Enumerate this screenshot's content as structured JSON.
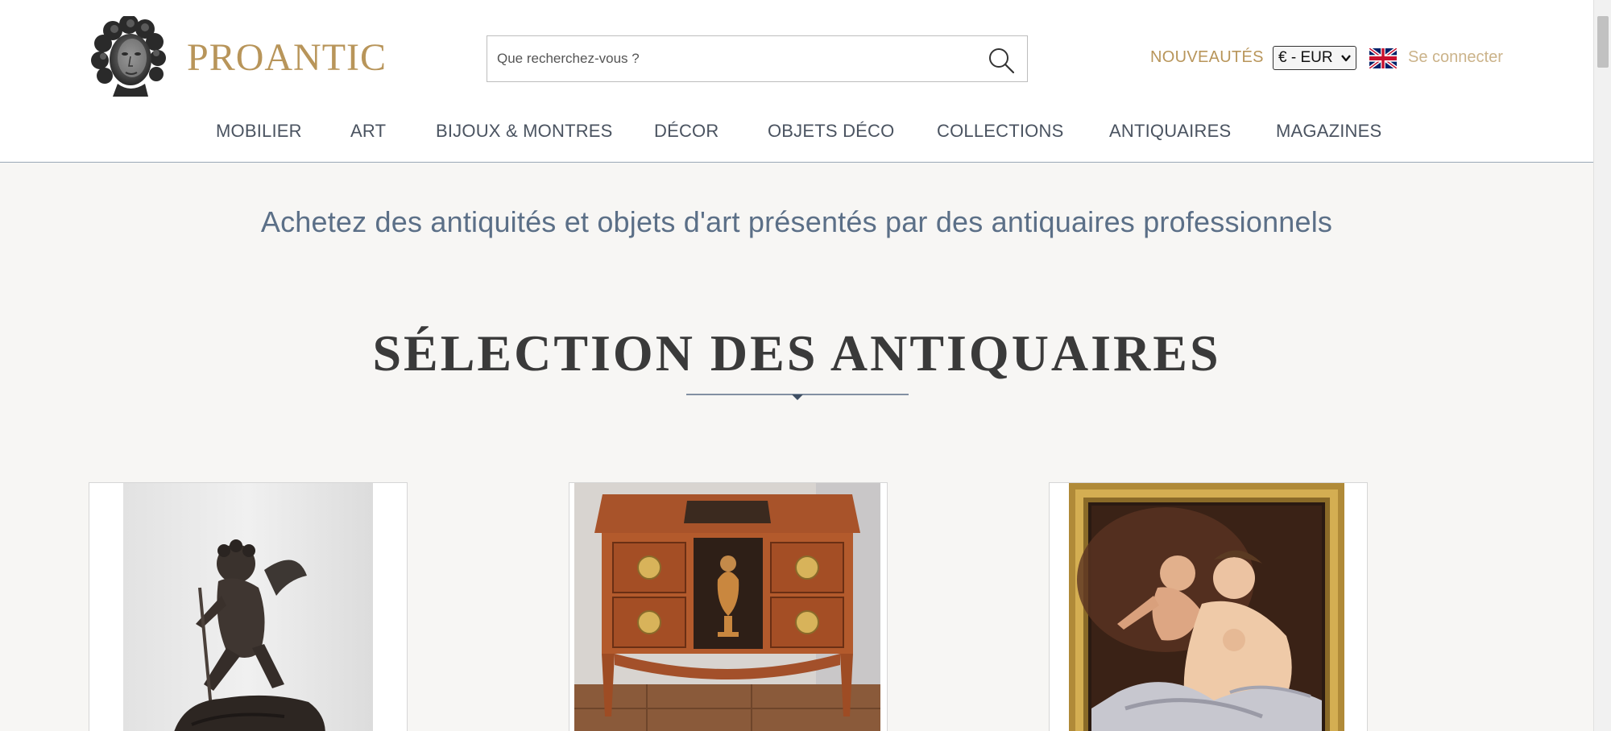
{
  "header": {
    "brand": "PROANTIC",
    "search": {
      "placeholder": "Que recherchez-vous ?"
    },
    "new_label": "NOUVEAUTÉS",
    "currency": "€ - EUR",
    "language_flag": "uk-flag-icon",
    "login_label": "Se connecter"
  },
  "nav": {
    "items": [
      {
        "label": "MOBILIER"
      },
      {
        "label": "ART"
      },
      {
        "label": "BIJOUX & MONTRES"
      },
      {
        "label": "DÉCOR"
      },
      {
        "label": "OBJETS DÉCO"
      },
      {
        "label": "COLLECTIONS"
      },
      {
        "label": "ANTIQUAIRES"
      },
      {
        "label": "MAGAZINES"
      }
    ]
  },
  "main": {
    "tagline": "Achetez des antiquités et objets d'art présentés par des antiquaires professionnels",
    "section_title": "SÉLECTION DES ANTIQUAIRES",
    "products": [
      {
        "image": "bronze-cupid-sculpture"
      },
      {
        "image": "marquetry-commode"
      },
      {
        "image": "framed-painting-venus-and-cupid"
      }
    ]
  },
  "colors": {
    "brand_gold": "#b8955a",
    "login_gold": "#cbb38a",
    "tagline_blue": "#5b6f87",
    "page_bg": "#f7f6f4"
  }
}
